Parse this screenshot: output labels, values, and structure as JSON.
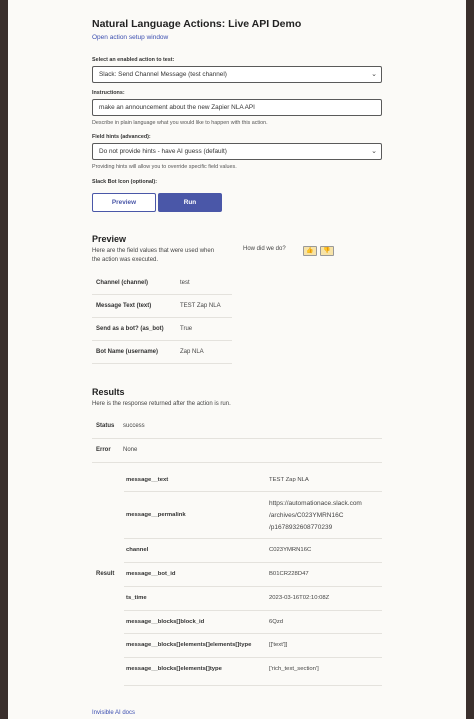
{
  "title": "Natural Language Actions: Live API Demo",
  "setup_link": "Open action setup window",
  "action": {
    "label": "Select an enabled action to test:",
    "value": "Slack: Send Channel Message (test channel)"
  },
  "instructions": {
    "label": "Instructions:",
    "value": "make an announcement about the new Zapier NLA API",
    "hint": "Describe in plain language what you would like to happen with this action."
  },
  "field_hints": {
    "label": "Field hints (advanced):",
    "value": "Do not provide hints - have AI guess (default)",
    "hint": "Providing hints will allow you to override specific field values."
  },
  "bot_icon_label": "Slack Bot Icon (optional):",
  "buttons": {
    "preview": "Preview",
    "run": "Run"
  },
  "preview": {
    "heading": "Preview",
    "desc_line1": "Here are the field values that were used when",
    "desc_line2": "the action was executed.",
    "feedback": "How did we do?",
    "rows": [
      {
        "k": "Channel (channel)",
        "v": "test"
      },
      {
        "k": "Message Text (text)",
        "v": "TEST Zap NLA"
      },
      {
        "k": "Send as a bot? (as_bot)",
        "v": "True"
      },
      {
        "k": "Bot Name (username)",
        "v": "Zap NLA"
      }
    ]
  },
  "results": {
    "heading": "Results",
    "desc": "Here is the response returned after the action is run.",
    "status_key": "Status",
    "status_val": "success",
    "error_key": "Error",
    "error_val": "None",
    "result_key": "Result",
    "rows": [
      {
        "k": "message__text",
        "v": "TEST Zap NLA"
      },
      {
        "k": "message__permalink",
        "v1": "https://automationace.slack.com",
        "v2": "/archives/C023YMRN16C",
        "v3": "/p1678932608770239"
      },
      {
        "k": "channel",
        "v": "C023YMRN16C"
      },
      {
        "k": "message__bot_id",
        "v": "B01CR228D47"
      },
      {
        "k": "ts_time",
        "v": "2023-03-16T02:10:08Z"
      },
      {
        "k": "message__blocks[]block_id",
        "v": "6Qzd"
      },
      {
        "k": "message__blocks[]elements[]elements[]type",
        "v": "[['text']]"
      },
      {
        "k": "message__blocks[]elements[]type",
        "v": "['rich_text_section']"
      }
    ]
  },
  "bottom_link": "Invisible AI docs"
}
